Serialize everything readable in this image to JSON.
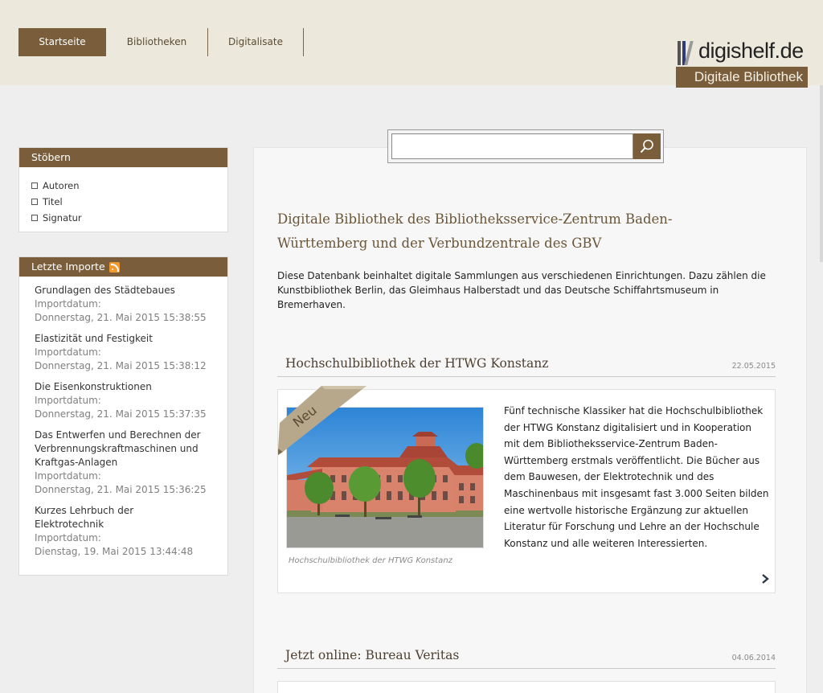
{
  "header": {
    "nav": [
      {
        "label": "Startseite",
        "active": true
      },
      {
        "label": "Bibliotheken",
        "active": false
      },
      {
        "label": "Digitalisate",
        "active": false
      }
    ],
    "logo": {
      "name": "digishelf.de",
      "subtitle": "Digitale Bibliothek"
    }
  },
  "sidebar": {
    "browse": {
      "title": "Stöbern",
      "items": [
        "Autoren",
        "Titel",
        "Signatur"
      ]
    },
    "imports": {
      "title": "Letzte Importe",
      "icon": "rss-icon",
      "label": "Importdatum:",
      "items": [
        {
          "title": "Grundlagen des Städtebaues",
          "date": "Donnerstag, 21. Mai 2015 15:38:55"
        },
        {
          "title": "Elastizität und Festigkeit",
          "date": "Donnerstag, 21. Mai 2015 15:38:12"
        },
        {
          "title": "Die Eisenkonstruktionen",
          "date": "Donnerstag, 21. Mai 2015 15:37:35"
        },
        {
          "title": "Das Entwerfen und Berechnen der Verbrennungskraftmaschinen und Kraftgas-Anlagen",
          "date": "Donnerstag, 21. Mai 2015 15:36:25"
        },
        {
          "title": "Kurzes Lehrbuch der Elektrotechnik",
          "date": "Dienstag, 19. Mai 2015 13:44:48"
        }
      ]
    }
  },
  "search": {
    "placeholder": "",
    "value": "",
    "button_icon": "search-icon"
  },
  "main": {
    "title": "Digitale Bibliothek des Bibliotheksservice-Zentrum Baden-Württemberg und der Verbundzentrale des GBV",
    "intro": "Diese Datenbank beinhaltet digitale Sammlungen aus verschiedenen Einrichtungen. Dazu zählen die Kunstbibliothek Berlin, das Gleimhaus Halberstadt und das Deutsche Schiffahrtsmuseum in Bremerhaven.",
    "news": [
      {
        "title": "Hochschulbibliothek der HTWG Konstanz",
        "date": "22.05.2015",
        "badge": "Neu",
        "caption": "Hochschulbibliothek der HTWG Konstanz",
        "text": "Fünf technische Klassiker hat die Hochschulbibliothek der HTWG Konstanz digitalisiert und in Kooperation mit dem Bibliotheksservice-Zentrum Baden-Württemberg erstmals veröffentlicht. Die Bücher aus dem Bauwesen, der Elektrotechnik und des Maschinenbaus mit insgesamt fast 3.000 Seiten bilden eine wertvolle historische Ergänzung zur aktuellen Literatur für Forschung und Lehre an der Hochschule Konstanz und alle weiteren Interessierten."
      },
      {
        "title": "Jetzt online: Bureau Veritas",
        "date": "04.06.2014"
      }
    ]
  },
  "colors": {
    "brand_brown": "#7a5e3c",
    "header_bg": "#ece9dc",
    "page_bg": "#eeeeee",
    "heading_text": "#6b5537"
  }
}
